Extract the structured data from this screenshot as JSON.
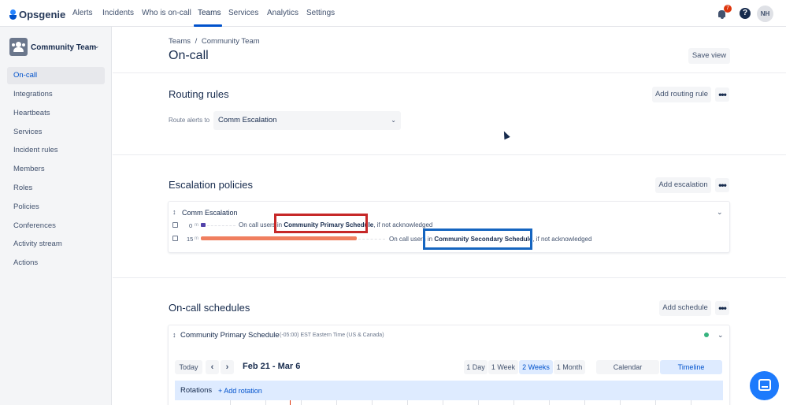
{
  "app": {
    "logo_text": "Opsgenie"
  },
  "topnav": {
    "items": [
      {
        "label": "Alerts"
      },
      {
        "label": "Incidents"
      },
      {
        "label": "Who is on-call"
      },
      {
        "label": "Teams"
      },
      {
        "label": "Services"
      },
      {
        "label": "Analytics"
      },
      {
        "label": "Settings"
      }
    ],
    "active": "Teams",
    "notification_count": "7",
    "help_glyph": "?",
    "avatar_initials": "NH"
  },
  "sidebar": {
    "team_name": "Community Team",
    "items": [
      {
        "label": "On-call"
      },
      {
        "label": "Integrations"
      },
      {
        "label": "Heartbeats"
      },
      {
        "label": "Services"
      },
      {
        "label": "Incident rules"
      },
      {
        "label": "Members"
      },
      {
        "label": "Roles"
      },
      {
        "label": "Policies"
      },
      {
        "label": "Conferences"
      },
      {
        "label": "Activity stream"
      },
      {
        "label": "Actions"
      }
    ],
    "active": "On-call"
  },
  "header": {
    "breadcrumb": [
      "Teams",
      "/",
      "Community Team"
    ],
    "title": "On-call",
    "save_view": "Save view"
  },
  "routing": {
    "heading": "Routing rules",
    "add_button": "Add routing rule",
    "route_label": "Route alerts to",
    "route_value": "Comm Escalation"
  },
  "escalation": {
    "heading": "Escalation policies",
    "add_button": "Add escalation",
    "policy_name": "Comm Escalation",
    "rules": [
      {
        "minutes": "0",
        "unit": "m",
        "prefix": "On call users in",
        "schedule": "Community Primary Schedule",
        "suffix": ", if not acknowledged"
      },
      {
        "minutes": "15",
        "unit": "m",
        "prefix": "On call users in",
        "schedule": "Community Secondary Schedule",
        "suffix": ", if not acknowledged"
      }
    ]
  },
  "schedules": {
    "heading": "On-call schedules",
    "add_button": "Add schedule",
    "schedule_name": "Community Primary Schedule",
    "timezone": "(-05:00) EST Eastern Time (US & Canada)",
    "today_button": "Today",
    "prev_glyph": "‹",
    "next_glyph": "›",
    "date_range": "Feb 21 - Mar 6",
    "ranges": [
      "1 Day",
      "1 Week",
      "2 Weeks",
      "1 Month"
    ],
    "selected_range": "2 Weeks",
    "views": [
      "Calendar",
      "Timeline"
    ],
    "selected_view": "Timeline",
    "rotations_label": "Rotations",
    "add_rotation": "+ Add rotation"
  },
  "colors": {
    "accent": "#0052cc",
    "highlight_red": "#c62828",
    "highlight_blue": "#1565c0",
    "bar_orange": "#f07f5f",
    "bar_purple": "#5243aa",
    "status_green": "#36b37e"
  },
  "icons": {
    "logo": "opsgenie-logo-icon",
    "bell": "bell-icon",
    "help": "help-icon",
    "team": "team-icon",
    "chat": "chat-icon"
  }
}
